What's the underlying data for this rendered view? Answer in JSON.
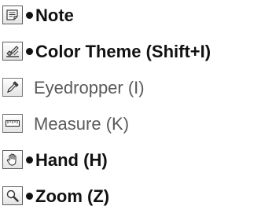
{
  "menu": {
    "items": [
      {
        "icon": "note-icon",
        "label": "Note",
        "selected": true
      },
      {
        "icon": "color-theme-icon",
        "label": "Color Theme (Shift+I)",
        "selected": true
      },
      {
        "icon": "eyedropper-icon",
        "label": "Eyedropper (I)",
        "selected": false
      },
      {
        "icon": "ruler-icon",
        "label": "Measure (K)",
        "selected": false
      },
      {
        "icon": "hand-icon",
        "label": "Hand (H)",
        "selected": true
      },
      {
        "icon": "zoom-icon",
        "label": "Zoom (Z)",
        "selected": true
      }
    ]
  },
  "colors": {
    "text_active": "#111111",
    "text_inactive": "#5a5a5a",
    "icon_border": "#5c5c5c",
    "icon_fill_top": "#ffffff",
    "icon_fill_bottom": "#e4e4e4"
  }
}
